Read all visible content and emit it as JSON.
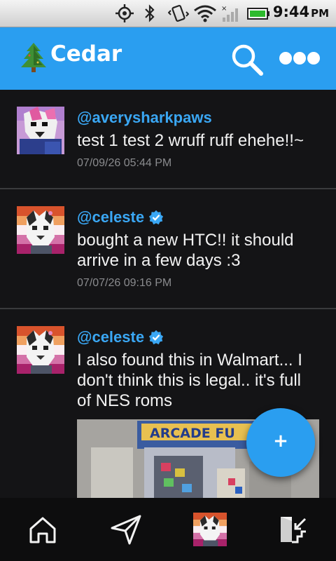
{
  "status_bar": {
    "time": "9:44",
    "ampm": "PM",
    "icons": [
      "gps-icon",
      "bluetooth-icon",
      "vibrate-icon",
      "wifi-icon",
      "signal-icon",
      "battery-icon"
    ]
  },
  "app_bar": {
    "title": "Cedar",
    "logo_icon": "tree-icon",
    "search_icon": "search-icon",
    "menu_icon": "more-dots-icon",
    "color": "#2a9ef0"
  },
  "feed": {
    "posts": [
      {
        "handle": "@averysharkpaws",
        "verified": false,
        "text": "test 1 test 2 wruff ruff ehehe!!~",
        "timestamp": "07/09/26 05:44 PM"
      },
      {
        "handle": "@celeste",
        "verified": true,
        "text": "bought a new HTC!! it should arrive in a few days :3",
        "timestamp": "07/07/26 09:16 PM"
      },
      {
        "handle": "@celeste",
        "verified": true,
        "text": "I also found this in Walmart... I don't think this is legal.. it's full of NES roms",
        "attachment": {
          "type": "image",
          "label": "ARCADE FU"
        }
      }
    ]
  },
  "fab": {
    "label": "+"
  },
  "bottom_nav": {
    "items": [
      "home-icon",
      "send-icon",
      "profile-avatar",
      "logout-icon"
    ]
  },
  "colors": {
    "accent": "#2a9ef0",
    "handle": "#3aa7f4",
    "background": "#141416",
    "text": "#f2f2f2",
    "muted": "#8a8b8e",
    "verified": "#3aa7f4"
  }
}
